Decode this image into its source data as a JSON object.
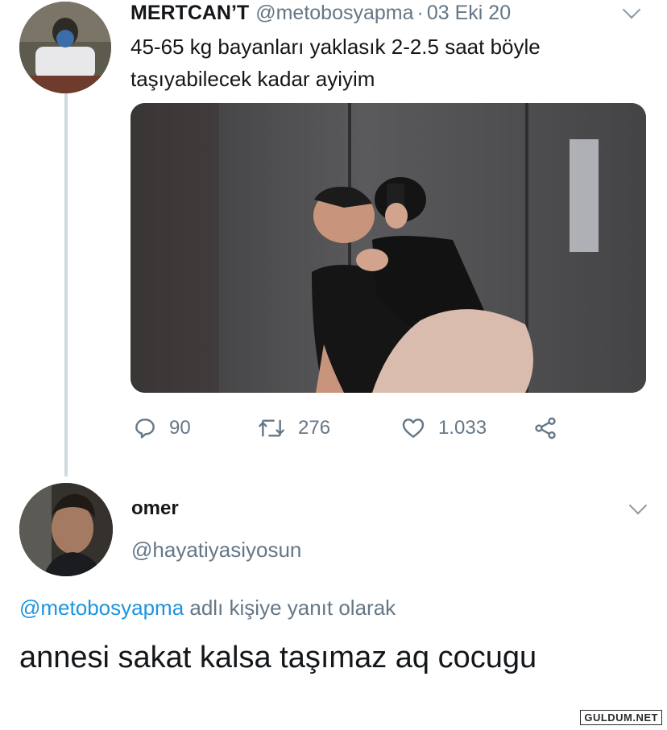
{
  "tweet": {
    "display_name": "MERTCAN’T",
    "handle": "@metobosyapma",
    "separator": "·",
    "date": "03 Eki 20",
    "text": "45-65 kg bayanları yaklasık 2-2.5 saat böyle taşıyabilecek kadar ayiyim",
    "actions": {
      "replies": "90",
      "retweets": "276",
      "likes": "1.033"
    }
  },
  "reply": {
    "display_name": "omer",
    "handle": "@hayatiyasiyosun",
    "context_mention": "@metobosyapma",
    "context_suffix": " adlı kişiye yanıt olarak",
    "text": "annesi sakat kalsa taşımaz aq cocugu"
  },
  "watermark": "GULDUM.NET",
  "colors": {
    "text": "#14171a",
    "secondary": "#657786",
    "mention": "#1b95e0",
    "thread_line": "#cfd9de"
  },
  "icons": [
    "reply-icon",
    "retweet-icon",
    "like-icon",
    "share-icon",
    "chevron-down-icon"
  ]
}
